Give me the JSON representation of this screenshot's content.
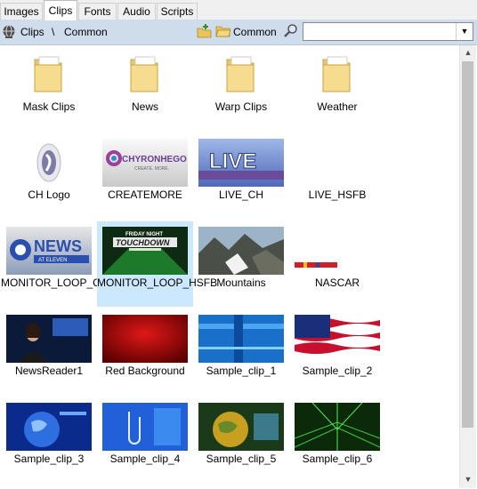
{
  "tabs": [
    {
      "label": "Images",
      "active": false
    },
    {
      "label": "Clips",
      "active": true
    },
    {
      "label": "Fonts",
      "active": false
    },
    {
      "label": "Audio",
      "active": false
    },
    {
      "label": "Scripts",
      "active": false
    }
  ],
  "pathbar": {
    "root_icon": "globe-icon",
    "crumb_root": "Clips",
    "separator": "\\",
    "crumb_current": "Common",
    "new_folder_icon": "new-folder-icon",
    "folder_icon": "open-folder-icon",
    "folder_label": "Common",
    "search_icon": "magnifier-icon",
    "search_value": "",
    "dropdown_icon": "chevron-down-icon"
  },
  "items": [
    {
      "label": "Mask Clips",
      "kind": "folder"
    },
    {
      "label": "News",
      "kind": "folder"
    },
    {
      "label": "Warp Clips",
      "kind": "folder"
    },
    {
      "label": "Weather",
      "kind": "folder"
    },
    {
      "label": "CH Logo",
      "kind": "logo"
    },
    {
      "label": "CREATEMORE",
      "kind": "createmore",
      "logo_text": "CHYRONHEGO",
      "logo_sub": "CREATE. MORE."
    },
    {
      "label": "LIVE_CH",
      "kind": "live",
      "logo_text": "LIVE"
    },
    {
      "label": "LIVE_HSFB",
      "kind": "empty"
    },
    {
      "label": "MONITOR_LOOP_C",
      "kind": "news",
      "logo_text": "NEWS",
      "logo_sub": "AT ELEVEN"
    },
    {
      "label": "MONITOR_LOOP_HSFB",
      "kind": "touchdown",
      "logo_text": "TOUCHDOWN",
      "logo_sub": "FRIDAY NIGHT",
      "selected": true
    },
    {
      "label": "Mountains",
      "kind": "mountains"
    },
    {
      "label": "NASCAR",
      "kind": "nascar"
    },
    {
      "label": "NewsReader1",
      "kind": "newsreader"
    },
    {
      "label": "Red Background",
      "kind": "red"
    },
    {
      "label": "Sample_clip_1",
      "kind": "blue_lines"
    },
    {
      "label": "Sample_clip_2",
      "kind": "flag"
    },
    {
      "label": "Sample_clip_3",
      "kind": "globe_blue"
    },
    {
      "label": "Sample_clip_4",
      "kind": "clips_blue"
    },
    {
      "label": "Sample_clip_5",
      "kind": "globe_gold"
    },
    {
      "label": "Sample_clip_6",
      "kind": "green_grid"
    }
  ],
  "scrollbar": {
    "up_icon": "arrow-up-icon",
    "down_icon": "arrow-down-icon",
    "position": 0.0
  }
}
